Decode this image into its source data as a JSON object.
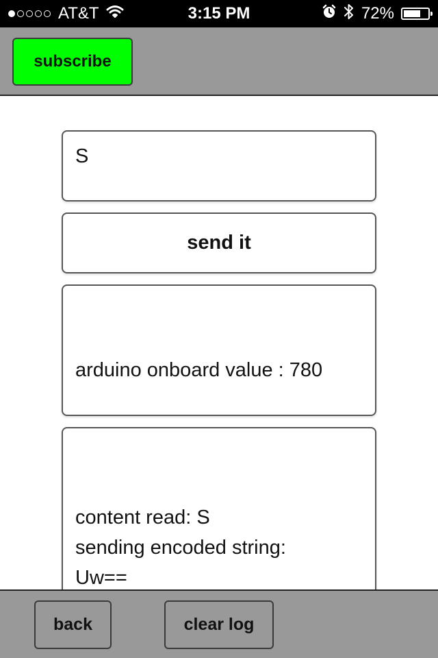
{
  "status_bar": {
    "signal_filled": 1,
    "signal_total": 5,
    "carrier": "AT&T",
    "time": "3:15 PM",
    "battery_percent_label": "72%",
    "battery_level": 0.72,
    "icons": [
      "wifi-icon",
      "alarm-icon",
      "bluetooth-icon",
      "battery-icon"
    ]
  },
  "toolbar": {
    "subscribe_label": "subscribe",
    "subscribe_color": "#00ff00"
  },
  "input": {
    "value": "S"
  },
  "send_button": {
    "label": "send it"
  },
  "value_display": {
    "text": "arduino onboard value : 780"
  },
  "log": {
    "lines": [
      "content read: S",
      "sending encoded string:",
      "Uw=="
    ]
  },
  "bottom_bar": {
    "back_label": "back",
    "clear_label": "clear log"
  },
  "colors": {
    "bar_background": "#999999",
    "status_background": "#000000",
    "subscribe_green": "#00ff00"
  }
}
